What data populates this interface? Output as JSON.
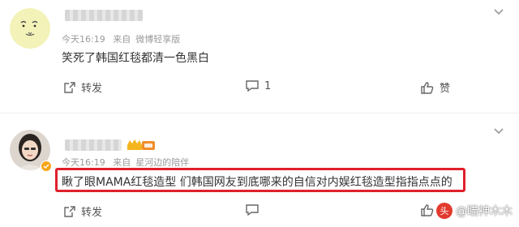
{
  "colors": {
    "highlight_border": "#e0202a",
    "meta_text": "#9a9a9a",
    "body_text": "#333333"
  },
  "comments": [
    {
      "meta": {
        "time": "今天16:19",
        "source_prefix": "来自",
        "source": "微博轻享版"
      },
      "text": "笑死了韩国红毯都清一色黑白",
      "actions": {
        "repost_label": "转发",
        "comment_count": "1",
        "like_label": "赞"
      },
      "icons": {
        "avatar": "sketch-avatar-icon",
        "more": "chevron-down-icon"
      }
    },
    {
      "meta": {
        "time": "今天16:19",
        "source_prefix": "来自",
        "source": "星河边的陪伴"
      },
      "text": "瞅了眼MAMA红毯造型 们韩国网友到底哪来的自信对内娱红毯造型指指点点的",
      "highlighted": true,
      "actions": {
        "repost_label": "转发",
        "comment_count": "",
        "like_label": ""
      },
      "icons": {
        "avatar": "photo-avatar-icon",
        "more": "chevron-down-icon",
        "badge": "fan-badge-icon"
      }
    }
  ],
  "watermark": {
    "logo_text": "头",
    "text": "@瞄神木木"
  }
}
